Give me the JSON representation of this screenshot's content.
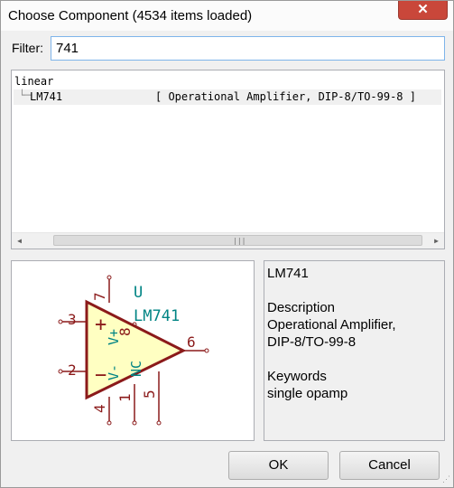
{
  "window": {
    "title": "Choose Component (4534 items loaded)",
    "close_icon": "✕"
  },
  "filter": {
    "label": "Filter:",
    "value": "741"
  },
  "tree": {
    "library": "linear",
    "items": [
      {
        "name": "LM741",
        "description": "[ Operational Amplifier, DIP-8/TO-99-8 ]"
      }
    ]
  },
  "scrollbar": {
    "left_icon": "◀",
    "right_icon": "▶",
    "grip_icon": "|||"
  },
  "symbol": {
    "ref": "U",
    "value": "LM741",
    "pins": {
      "p1": "1",
      "p2": "2",
      "p3": "3",
      "p4": "4",
      "p5": "5",
      "p6": "6",
      "p7": "7",
      "p8": "8"
    },
    "pin_names": {
      "vplus": "V+",
      "vminus": "V-",
      "nc": "NC",
      "plus": "+",
      "minus": "−"
    },
    "colors": {
      "body": "#8b1a1a",
      "fill": "#ffffc2",
      "text": "#008484"
    }
  },
  "info": {
    "name": "LM741",
    "description_heading": "Description",
    "description_line1": "Operational Amplifier,",
    "description_line2": "DIP-8/TO-99-8",
    "keywords_heading": "Keywords",
    "keywords": "single opamp"
  },
  "buttons": {
    "ok": "OK",
    "cancel": "Cancel"
  }
}
